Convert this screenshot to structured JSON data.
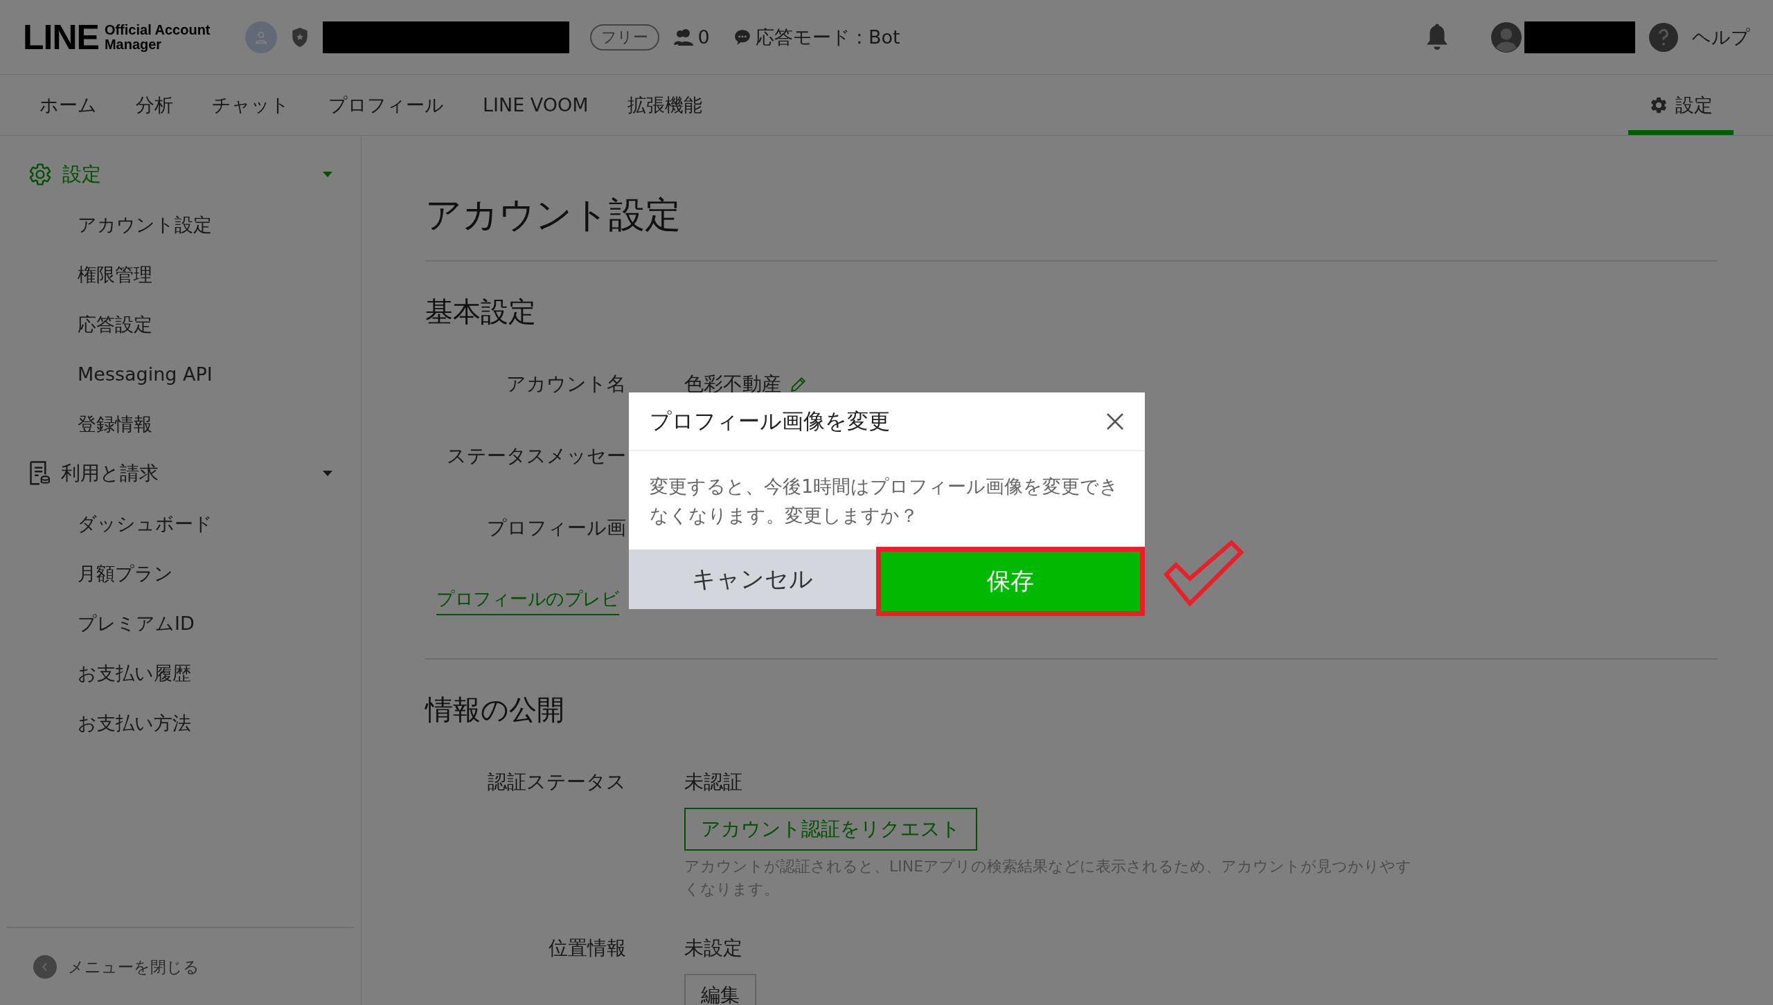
{
  "header": {
    "logo": {
      "wordmark": "LINE",
      "subtitle_lines": [
        "Official Account",
        "Manager"
      ]
    },
    "plan_badge": "フリー",
    "friends_count": "0",
    "response_mode": "応答モード : Bot",
    "help": "ヘルプ"
  },
  "nav": {
    "tabs": [
      {
        "label": "ホーム",
        "kind": "plain",
        "selected": false
      },
      {
        "label": "分析",
        "kind": "plain",
        "selected": false
      },
      {
        "label": "チャット",
        "kind": "plain",
        "selected": false
      },
      {
        "label": "プロフィール",
        "kind": "plain",
        "selected": false
      },
      {
        "label": "LINE VOOM",
        "kind": "plain",
        "selected": false
      },
      {
        "label": "拡張機能",
        "kind": "plain",
        "selected": false
      },
      {
        "label": "設定",
        "kind": "settings",
        "selected": true
      }
    ]
  },
  "sidebar": {
    "groups": [
      {
        "label": "設定",
        "kind": "settings",
        "active": true,
        "expanded": true,
        "items": [
          "アカウント設定",
          "権限管理",
          "応答設定",
          "Messaging API",
          "登録情報"
        ]
      },
      {
        "label": "利用と請求",
        "kind": "billing",
        "active": false,
        "expanded": true,
        "items": [
          "ダッシュボード",
          "月額プラン",
          "プレミアムID",
          "お支払い履歴",
          "お支払い方法"
        ]
      }
    ],
    "footer": "メニューを閉じる"
  },
  "main": {
    "title": "アカウント設定",
    "sections": [
      {
        "heading": "基本設定",
        "fields": [
          {
            "label": "アカウント名",
            "value": "色彩不動産",
            "editable": true
          },
          {
            "label": "ステータスメッセー"
          },
          {
            "label": "プロフィール画"
          }
        ],
        "link": "プロフィールのプレビ"
      },
      {
        "heading": "情報の公開",
        "fields": [
          {
            "label": "認証ステータス",
            "value": "未認証",
            "button": {
              "label": "アカウント認証をリクエスト",
              "kind": "primary"
            },
            "note": "アカウントが認証されると、LINEアプリの検索結果などに表示されるため、アカウントが見つかりやすくなります。"
          },
          {
            "label": "位置情報",
            "value": "未設定",
            "button": {
              "label": "編集",
              "kind": "secondary"
            }
          }
        ]
      }
    ]
  },
  "dialog": {
    "title": "プロフィール画像を変更",
    "message": "変更すると、今後1時間はプロフィール画像を変更できなくなります。変更しますか？",
    "buttons": [
      {
        "label": "キャンセル",
        "kind": "cancel",
        "highlighted": false
      },
      {
        "label": "保存",
        "kind": "primary",
        "highlighted": true
      }
    ]
  }
}
